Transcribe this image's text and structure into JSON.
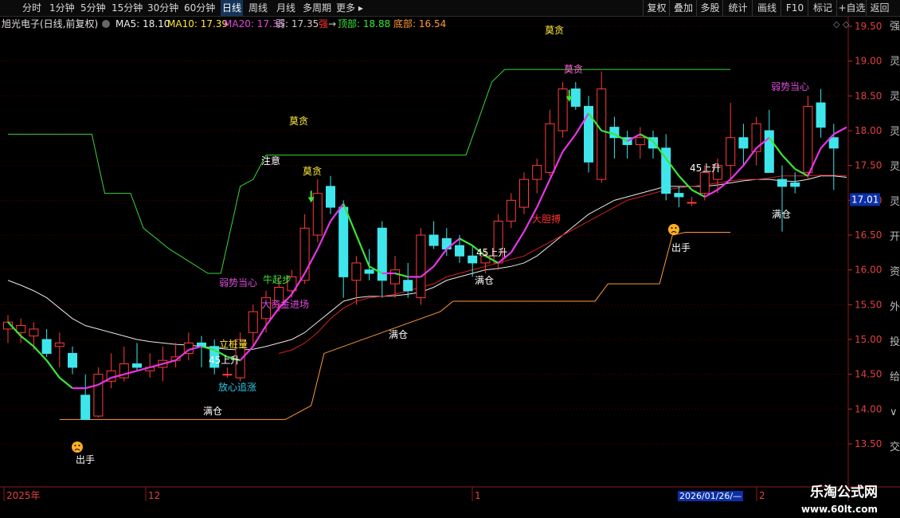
{
  "toolbar": {
    "left": [
      "分时",
      "1分钟",
      "5分钟",
      "15分钟",
      "30分钟",
      "60分钟",
      "日线",
      "周线",
      "月线",
      "多周期",
      "更多 ▸"
    ],
    "active_index": 6,
    "right": [
      "复权",
      "叠加",
      "多股",
      "统计",
      "画线",
      "F10",
      "标记",
      "+自选",
      "返回"
    ]
  },
  "header": {
    "stock": "旭光电子(日线,前复权)",
    "ma5": "MA5: 18.10",
    "ma10": "MA10: 17.39",
    "ma20": "MA20: 17.35",
    "weak": "弱: 17.35",
    "strong": "强",
    "arrow": "→",
    "top": "顶部: 18.88",
    "bottom": "底部: 16.54"
  },
  "price_axis": {
    "ticks": [
      "19.50",
      "19.00",
      "18.50",
      "18.00",
      "17.50",
      "17.00",
      "16.50",
      "16.00",
      "15.50",
      "15.00",
      "14.50",
      "14.00",
      "13.50"
    ],
    "current": "17.01"
  },
  "date_axis": {
    "labels": [
      "2025年",
      "12",
      "1",
      "2026/01/26/—",
      "2"
    ]
  },
  "right_panel_chars": [
    "强",
    "灵",
    "灵",
    "灵",
    "灵",
    "灵",
    "开",
    "资",
    "外",
    "投",
    "给",
    "∨",
    "交"
  ],
  "annotations": [
    {
      "text": "莫贪",
      "color": "#ffea3a"
    },
    {
      "text": "莫贪",
      "color": "#ff6ad5"
    },
    {
      "text": "莫贪",
      "color": "#ffea3a"
    },
    {
      "text": "莫贪",
      "color": "#ffea3a"
    },
    {
      "text": "注意",
      "color": "#ffffff"
    },
    {
      "text": "弱势当心",
      "color": "#e04ce0"
    },
    {
      "text": "弱势当心",
      "color": "#e04ce0"
    },
    {
      "text": "牛起步",
      "color": "#39e639"
    },
    {
      "text": "大资金进场",
      "color": "#e04ce0"
    },
    {
      "text": "立桩量",
      "color": "#ffea3a"
    },
    {
      "text": "45上升",
      "color": "#ffffff"
    },
    {
      "text": "45上升",
      "color": "#ffffff"
    },
    {
      "text": "45上升",
      "color": "#ffffff"
    },
    {
      "text": "放心追涨",
      "color": "#2ec8e6"
    },
    {
      "text": "满仓",
      "color": "#ffffff"
    },
    {
      "text": "满仓",
      "color": "#ffffff"
    },
    {
      "text": "满仓",
      "color": "#ffffff"
    },
    {
      "text": "满仓",
      "color": "#ffffff"
    },
    {
      "text": "出手",
      "color": "#ffffff"
    },
    {
      "text": "出手",
      "color": "#ffffff"
    },
    {
      "text": "大胆搏",
      "color": "#ff3030"
    }
  ],
  "watermark": {
    "brand": "乐淘公式网",
    "url": "www.60lt.com"
  },
  "colors": {
    "up": "#ff3b3b",
    "down": "#3ee6ec",
    "ma5_up": "#e636e6",
    "ma5_down": "#39e639",
    "resistance": "#3ad43a",
    "support": "#ff9a3a",
    "white_line": "#e8e8e8",
    "red_line": "#d42020",
    "grid": "#5a0000"
  },
  "chart_data": {
    "type": "candlestick",
    "ylim": [
      13.2,
      19.7
    ],
    "candles": [
      {
        "o": 15.15,
        "h": 15.35,
        "l": 14.95,
        "c": 15.25
      },
      {
        "o": 15.1,
        "h": 15.3,
        "l": 14.95,
        "c": 15.2
      },
      {
        "o": 15.05,
        "h": 15.25,
        "l": 14.85,
        "c": 15.15
      },
      {
        "o": 15.0,
        "h": 15.15,
        "l": 14.75,
        "c": 14.8
      },
      {
        "o": 14.9,
        "h": 15.1,
        "l": 14.6,
        "c": 14.95
      },
      {
        "o": 14.8,
        "h": 14.9,
        "l": 14.5,
        "c": 14.6
      },
      {
        "o": 14.2,
        "h": 14.5,
        "l": 13.85,
        "c": 13.85
      },
      {
        "o": 13.9,
        "h": 14.6,
        "l": 13.88,
        "c": 14.5
      },
      {
        "o": 14.4,
        "h": 14.8,
        "l": 14.3,
        "c": 14.55
      },
      {
        "o": 14.45,
        "h": 14.9,
        "l": 14.4,
        "c": 14.65
      },
      {
        "o": 14.65,
        "h": 14.95,
        "l": 14.55,
        "c": 14.6
      },
      {
        "o": 14.55,
        "h": 14.8,
        "l": 14.45,
        "c": 14.6
      },
      {
        "o": 14.6,
        "h": 14.9,
        "l": 14.4,
        "c": 14.7
      },
      {
        "o": 14.7,
        "h": 14.95,
        "l": 14.6,
        "c": 14.75
      },
      {
        "o": 14.8,
        "h": 15.1,
        "l": 14.7,
        "c": 14.95
      },
      {
        "o": 14.95,
        "h": 15.05,
        "l": 14.6,
        "c": 14.9
      },
      {
        "o": 14.9,
        "h": 15.0,
        "l": 14.5,
        "c": 14.6
      },
      {
        "o": 14.5,
        "h": 14.6,
        "l": 14.45,
        "c": 14.5
      },
      {
        "o": 14.45,
        "h": 15.1,
        "l": 14.4,
        "c": 15.0
      },
      {
        "o": 15.1,
        "h": 15.5,
        "l": 14.9,
        "c": 15.4
      },
      {
        "o": 15.3,
        "h": 15.7,
        "l": 15.1,
        "c": 15.6
      },
      {
        "o": 15.5,
        "h": 15.9,
        "l": 15.4,
        "c": 15.75
      },
      {
        "o": 15.7,
        "h": 16.0,
        "l": 15.6,
        "c": 15.9
      },
      {
        "o": 15.85,
        "h": 16.8,
        "l": 15.8,
        "c": 16.6
      },
      {
        "o": 16.5,
        "h": 17.3,
        "l": 16.4,
        "c": 17.1
      },
      {
        "o": 17.2,
        "h": 17.35,
        "l": 16.8,
        "c": 16.9
      },
      {
        "o": 16.9,
        "h": 17.0,
        "l": 15.6,
        "c": 15.9
      },
      {
        "o": 15.85,
        "h": 16.2,
        "l": 15.5,
        "c": 16.1
      },
      {
        "o": 16.0,
        "h": 16.3,
        "l": 15.85,
        "c": 15.95
      },
      {
        "o": 16.6,
        "h": 16.7,
        "l": 15.6,
        "c": 15.85
      },
      {
        "o": 15.8,
        "h": 16.2,
        "l": 15.6,
        "c": 16.0
      },
      {
        "o": 15.85,
        "h": 16.1,
        "l": 15.6,
        "c": 15.7
      },
      {
        "o": 15.6,
        "h": 16.6,
        "l": 15.5,
        "c": 16.5
      },
      {
        "o": 16.5,
        "h": 16.7,
        "l": 16.3,
        "c": 16.35
      },
      {
        "o": 16.45,
        "h": 16.6,
        "l": 16.2,
        "c": 16.3
      },
      {
        "o": 16.35,
        "h": 16.5,
        "l": 16.1,
        "c": 16.2
      },
      {
        "o": 16.2,
        "h": 16.35,
        "l": 15.9,
        "c": 16.1
      },
      {
        "o": 16.1,
        "h": 16.3,
        "l": 15.95,
        "c": 16.2
      },
      {
        "o": 16.1,
        "h": 16.8,
        "l": 16.0,
        "c": 16.7
      },
      {
        "o": 16.7,
        "h": 17.1,
        "l": 16.6,
        "c": 17.0
      },
      {
        "o": 16.9,
        "h": 17.4,
        "l": 16.8,
        "c": 17.3
      },
      {
        "o": 17.3,
        "h": 17.6,
        "l": 17.1,
        "c": 17.5
      },
      {
        "o": 17.4,
        "h": 18.3,
        "l": 17.35,
        "c": 18.1
      },
      {
        "o": 18.0,
        "h": 18.7,
        "l": 17.9,
        "c": 18.6
      },
      {
        "o": 18.6,
        "h": 18.7,
        "l": 18.3,
        "c": 18.35
      },
      {
        "o": 18.35,
        "h": 18.5,
        "l": 17.4,
        "c": 17.55
      },
      {
        "o": 17.3,
        "h": 18.85,
        "l": 17.25,
        "c": 18.6
      },
      {
        "o": 18.05,
        "h": 18.2,
        "l": 17.6,
        "c": 17.9
      },
      {
        "o": 17.9,
        "h": 18.0,
        "l": 17.6,
        "c": 17.8
      },
      {
        "o": 17.8,
        "h": 18.05,
        "l": 17.6,
        "c": 17.9
      },
      {
        "o": 17.9,
        "h": 18.0,
        "l": 17.6,
        "c": 17.75
      },
      {
        "o": 17.75,
        "h": 17.95,
        "l": 17.0,
        "c": 17.1
      },
      {
        "o": 17.1,
        "h": 17.2,
        "l": 16.9,
        "c": 17.05
      },
      {
        "o": 16.97,
        "h": 17.05,
        "l": 16.92,
        "c": 16.97
      },
      {
        "o": 17.1,
        "h": 17.5,
        "l": 17.0,
        "c": 17.4
      },
      {
        "o": 17.3,
        "h": 17.6,
        "l": 17.1,
        "c": 17.5
      },
      {
        "o": 17.5,
        "h": 18.4,
        "l": 17.3,
        "c": 17.9
      },
      {
        "o": 17.9,
        "h": 18.1,
        "l": 17.5,
        "c": 17.75
      },
      {
        "o": 17.7,
        "h": 18.2,
        "l": 17.5,
        "c": 18.1
      },
      {
        "o": 18.0,
        "h": 18.3,
        "l": 17.4,
        "c": 17.4
      },
      {
        "o": 17.3,
        "h": 17.5,
        "l": 16.55,
        "c": 17.2
      },
      {
        "o": 17.25,
        "h": 17.4,
        "l": 17.1,
        "c": 17.2
      },
      {
        "o": 17.4,
        "h": 18.5,
        "l": 17.3,
        "c": 18.35
      },
      {
        "o": 18.4,
        "h": 18.6,
        "l": 17.9,
        "c": 18.05
      },
      {
        "o": 17.9,
        "h": 18.1,
        "l": 17.15,
        "c": 17.75
      }
    ],
    "ma5": [
      15.25,
      15.05,
      14.9,
      14.7,
      14.45,
      14.3,
      14.3,
      14.35,
      14.45,
      14.5,
      14.55,
      14.6,
      14.65,
      14.7,
      14.85,
      14.9,
      14.85,
      14.75,
      14.7,
      14.9,
      15.2,
      15.45,
      15.65,
      15.95,
      16.3,
      16.7,
      16.95,
      16.5,
      16.05,
      15.95,
      15.95,
      15.9,
      15.9,
      16.05,
      16.3,
      16.45,
      16.35,
      16.2,
      16.1,
      16.25,
      16.55,
      16.9,
      17.3,
      17.7,
      17.95,
      18.25,
      18.0,
      17.95,
      17.85,
      17.95,
      17.85,
      17.6,
      17.35,
      17.15,
      17.05,
      17.15,
      17.3,
      17.5,
      17.75,
      17.9,
      17.65,
      17.45,
      17.35,
      17.75,
      17.95,
      18.05
    ],
    "white_line": [
      15.85,
      15.78,
      15.7,
      15.6,
      15.45,
      15.3,
      15.2,
      15.15,
      15.1,
      15.05,
      15.0,
      14.97,
      14.95,
      14.93,
      14.92,
      14.9,
      14.88,
      14.86,
      14.85,
      14.86,
      14.9,
      14.95,
      15.0,
      15.1,
      15.25,
      15.4,
      15.55,
      15.6,
      15.62,
      15.62,
      15.63,
      15.65,
      15.68,
      15.75,
      15.85,
      15.9,
      15.95,
      16.0,
      16.02,
      16.05,
      16.1,
      16.2,
      16.35,
      16.5,
      16.65,
      16.8,
      16.9,
      17.0,
      17.05,
      17.1,
      17.15,
      17.2,
      17.2,
      17.2,
      17.2,
      17.22,
      17.25,
      17.28,
      17.3,
      17.3,
      17.28,
      17.27,
      17.3,
      17.35,
      17.35,
      17.33
    ],
    "red_line": [
      null,
      null,
      null,
      null,
      null,
      null,
      null,
      null,
      null,
      null,
      null,
      null,
      null,
      null,
      null,
      null,
      null,
      null,
      null,
      null,
      null,
      14.8,
      14.85,
      14.95,
      15.1,
      15.3,
      15.45,
      15.55,
      15.6,
      15.62,
      15.65,
      15.7,
      15.75,
      15.8,
      15.9,
      15.95,
      16.0,
      16.05,
      16.1,
      16.15,
      16.2,
      16.3,
      16.4,
      16.5,
      16.6,
      16.7,
      16.8,
      16.9,
      17.0,
      17.05,
      17.1,
      17.15,
      17.18,
      17.2,
      17.22,
      17.25,
      17.28,
      17.3,
      17.3,
      17.32,
      17.35,
      17.35,
      17.35,
      17.36,
      17.36,
      17.35
    ],
    "resistance": [
      {
        "x": 0,
        "y": 17.95
      },
      {
        "x": 6.5,
        "y": 17.95
      },
      {
        "x": 7.5,
        "y": 17.1
      },
      {
        "x": 9.5,
        "y": 17.1
      },
      {
        "x": 10.5,
        "y": 16.6
      },
      {
        "x": 12.5,
        "y": 16.3
      },
      {
        "x": 15.5,
        "y": 15.95
      },
      {
        "x": 16.5,
        "y": 15.95
      },
      {
        "x": 18,
        "y": 17.2
      },
      {
        "x": 19,
        "y": 17.3
      },
      {
        "x": 20,
        "y": 17.65
      },
      {
        "x": 35.5,
        "y": 17.65
      },
      {
        "x": 37.5,
        "y": 18.7
      },
      {
        "x": 38.5,
        "y": 18.88
      },
      {
        "x": 56,
        "y": 18.88
      }
    ],
    "support": [
      {
        "x": 4,
        "y": 13.85
      },
      {
        "x": 21.5,
        "y": 13.85
      },
      {
        "x": 23.5,
        "y": 14.05
      },
      {
        "x": 24.5,
        "y": 14.8
      },
      {
        "x": 33.5,
        "y": 15.4
      },
      {
        "x": 34.5,
        "y": 15.55
      },
      {
        "x": 45.5,
        "y": 15.55
      },
      {
        "x": 46.5,
        "y": 15.8
      },
      {
        "x": 50.5,
        "y": 15.8
      },
      {
        "x": 51.5,
        "y": 16.5
      },
      {
        "x": 52.5,
        "y": 16.54
      },
      {
        "x": 56,
        "y": 16.54
      }
    ]
  }
}
